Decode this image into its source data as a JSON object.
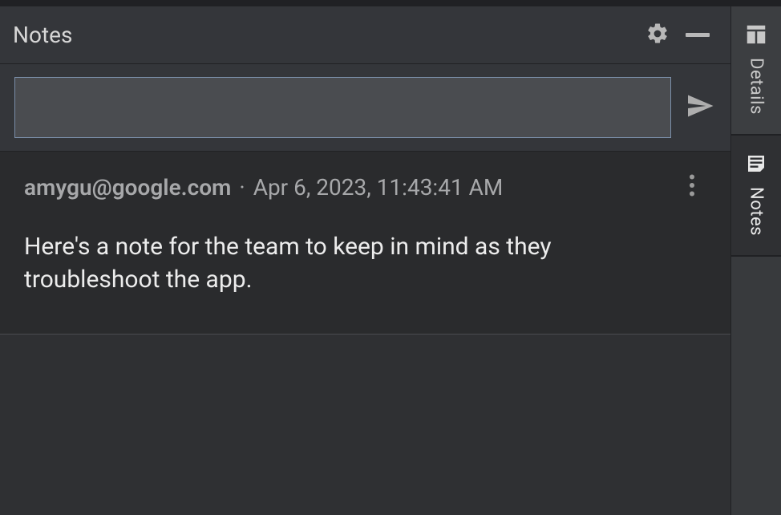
{
  "panel": {
    "title": "Notes"
  },
  "compose": {
    "value": "",
    "placeholder": ""
  },
  "notes": [
    {
      "author": "amygu@google.com",
      "separator": "·",
      "timestamp": "Apr 6, 2023, 11:43:41 AM",
      "body": "Here's a note for the team to keep in mind as they troubleshoot the app."
    }
  ],
  "sideTabs": {
    "details": "Details",
    "notes": "Notes"
  }
}
